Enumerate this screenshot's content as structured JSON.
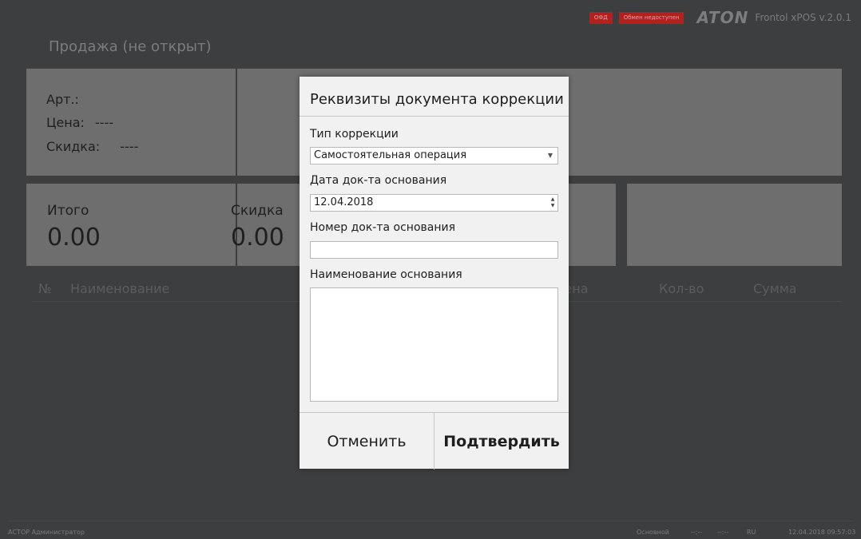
{
  "topbar": {
    "ofd_badge": "ОФД",
    "exchange_badge": "Обмен недоступен",
    "logo": "ATON",
    "version": "Frontol xPOS v.2.0.1"
  },
  "page_title": "Продажа (не открыт)",
  "item_info": {
    "art_label": "Арт.:",
    "price_label": "Цена:",
    "price_value": "----",
    "discount_label": "Скидка:",
    "discount_value": "----"
  },
  "totals": {
    "total_label": "Итого",
    "total_value": "0.00",
    "discount_label": "Скидка",
    "discount_value": "0.00"
  },
  "table_headers": {
    "num": "№",
    "name": "Наименование",
    "price": "Цена",
    "qty": "Кол-во",
    "sum": "Сумма"
  },
  "statusbar": {
    "left": "АСТОР Администратор",
    "mode": "Основной",
    "t1": "--:--",
    "t2": "--:--",
    "lang": "RU",
    "datetime": "12.04.2018 09:57:03"
  },
  "dialog": {
    "title": "Реквизиты документа коррекции",
    "type_label": "Тип коррекции",
    "type_value": "Самостоятельная операция",
    "date_label": "Дата док-та основания",
    "date_value": "12.04.2018",
    "number_label": "Номер док-та основания",
    "number_value": "",
    "reason_label": "Наименование основания",
    "reason_value": "",
    "cancel_label": "Отменить",
    "confirm_label": "Подтвердить"
  }
}
